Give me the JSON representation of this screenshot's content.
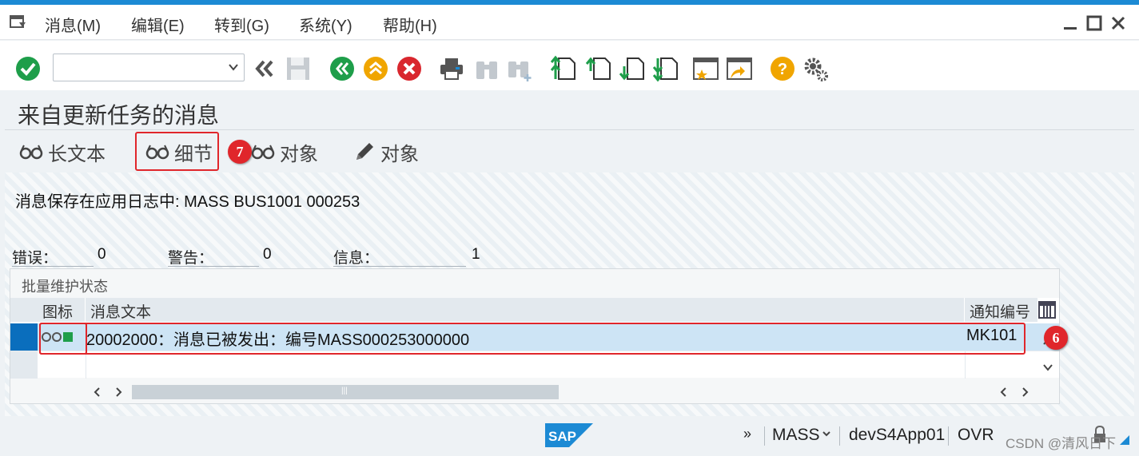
{
  "menubar": {
    "items": [
      "消息(M)",
      "编辑(E)",
      "转到(G)",
      "系统(Y)",
      "帮助(H)"
    ]
  },
  "toolbar": {
    "command_field_value": "",
    "icons": [
      "enter-icon",
      "command-dropdown-icon",
      "collapse-icon",
      "save-icon",
      "back-icon",
      "exit-icon",
      "cancel-icon",
      "print-icon",
      "find-icon",
      "find-next-icon",
      "first-page-icon",
      "previous-page-icon",
      "next-page-icon",
      "last-page-icon",
      "new-session-icon",
      "shortcut-icon",
      "help-icon",
      "settings-icon"
    ]
  },
  "title": "来自更新任务的消息",
  "app_toolbar": {
    "long_text": "长文本",
    "details": "细节",
    "object_display": "对象",
    "object_edit": "对象"
  },
  "annotations": {
    "badge_details": "7",
    "badge_row": "6"
  },
  "content": {
    "log_message": "消息保存在应用日志中: MASS BUS1001 000253",
    "stats": {
      "error_label": "错误：",
      "error_value": "0",
      "warning_label": "警告：",
      "warning_value": "0",
      "info_label": "信息：",
      "info_value": "1"
    },
    "panel_title": "批量维护状态",
    "columns": [
      "图标",
      "消息文本",
      "通知编号"
    ],
    "rows": [
      {
        "status": "green",
        "text": "20002000：消息已被发出：编号MASS000253000000",
        "notification": "MK101"
      }
    ]
  },
  "statusbar": {
    "transaction": "MASS",
    "system": "devS4App01",
    "mode": "OVR",
    "watermark": "CSDN @清风日下"
  },
  "colors": {
    "accent": "#1c8ad4",
    "highlight": "#e0262b",
    "row_selected": "#cde4f5",
    "green": "#1e9e4a",
    "orange": "#f0a500",
    "red": "#d9272e"
  }
}
